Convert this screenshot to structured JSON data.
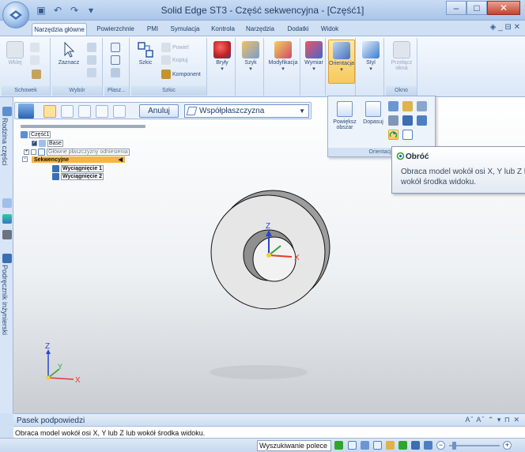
{
  "window": {
    "title": "Solid Edge ST3 - Część sekwencyjna - [Część1]",
    "minimize": "–",
    "maximize": "□",
    "close": "✕"
  },
  "quick_access": [
    "save-icon",
    "undo-icon",
    "redo-icon",
    "customize-icon"
  ],
  "ribbon": {
    "tabs": [
      {
        "label": "Narzędzia główne",
        "active": true
      },
      {
        "label": "Powierzchnie"
      },
      {
        "label": "PMI"
      },
      {
        "label": "Symulacja"
      },
      {
        "label": "Kontrola"
      },
      {
        "label": "Narzędzia"
      },
      {
        "label": "Dodatki"
      },
      {
        "label": "Widok"
      }
    ],
    "right_controls": "◈ _ ⊟ ✕",
    "groups": {
      "clipboard": {
        "label": "Schowek",
        "paste": "Wklej"
      },
      "select": {
        "label": "Wybór",
        "select_tool": "Zaznacz"
      },
      "planes": {
        "label": "Płasz..."
      },
      "sketch": {
        "label": "Szkic",
        "sketch": "Szkic",
        "repeat": "Powiel",
        "copy": "Kopiuj",
        "component": "Komponent"
      },
      "solids": {
        "label": "Bryły"
      },
      "pattern": {
        "label": "Szyk"
      },
      "modify": {
        "label": "Modyfikacja"
      },
      "dimension": {
        "label": "Wymiar"
      },
      "orient": {
        "label": "Orientacja"
      },
      "style": {
        "label": "Styl"
      },
      "window": {
        "label": "Okno",
        "switch": "Przełącz okna"
      }
    }
  },
  "left_strip": {
    "family_of_parts": "Rodzina części",
    "engineering_handbook": "Podręcznik inżynierski"
  },
  "command_bar": {
    "cancel": "Anuluj",
    "plane_value": "Współpłaszczyzna"
  },
  "tree": {
    "root": "Część1",
    "items": [
      {
        "label": "Base",
        "checked": true
      },
      {
        "label": "Główne płaszczyzny odniesienia",
        "checked": false
      },
      {
        "label": "Sekwencyjne",
        "highlight": true
      },
      {
        "label": "Wyciągnięcie 1"
      },
      {
        "label": "Wyciągnięcie 2"
      }
    ]
  },
  "orient_panel": {
    "zoom_area": "Powiększ obszar",
    "fit": "Dopasuj",
    "label": "Orientacja"
  },
  "tooltip": {
    "title": "Obróć",
    "body_line1": "Obraca model wokół osi X, Y lub Z lub",
    "body_line2": "wokół środka widoku."
  },
  "axes": {
    "z": "Z",
    "y": "Y",
    "x": "X"
  },
  "hint_pane": {
    "title": "Pasek podpowiedzi",
    "tools": "Aˇ Aˇ ⌃ ▾ ⊓ ✕",
    "text": "Obraca model wokół osi X, Y lub Z lub wokół środka widoku."
  },
  "status_bar": {
    "command_search": "Wyszukiwanie polece"
  },
  "colors": {
    "accent": "#f9b440",
    "axis_x": "#e23b2b",
    "axis_y": "#2fa52f",
    "axis_z": "#2b46c9"
  }
}
